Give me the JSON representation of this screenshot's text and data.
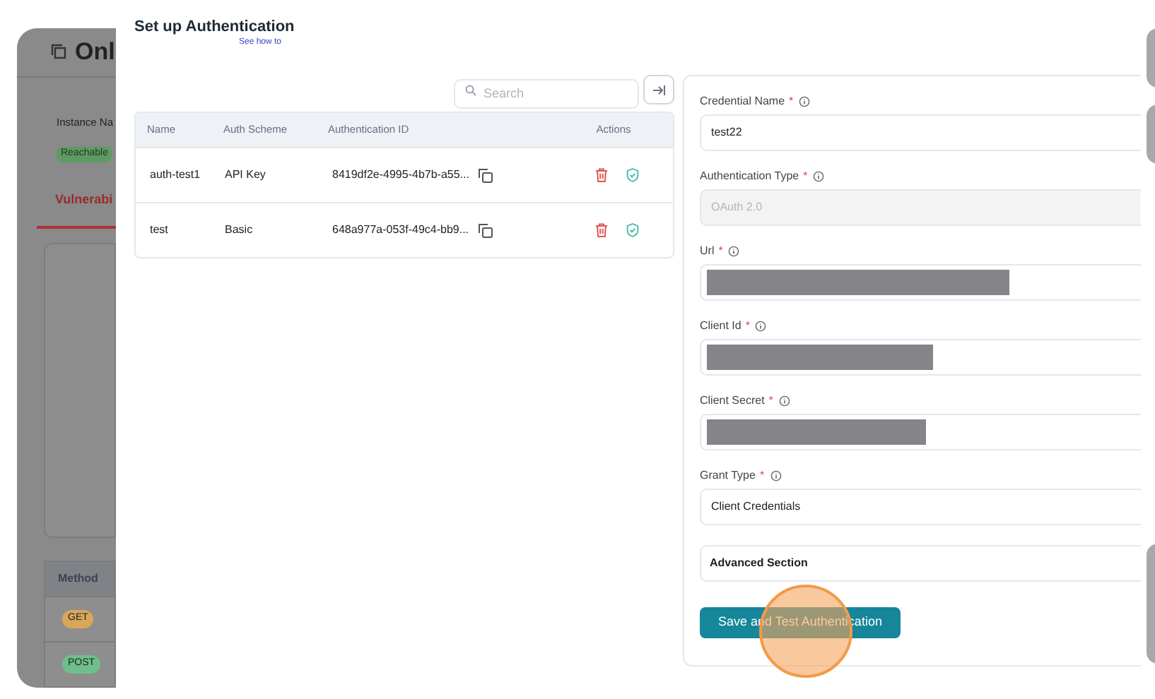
{
  "background_page": {
    "title": "Onl",
    "instance_label": "Instance Na",
    "status_badge": "Reachable",
    "tab": "Vulnerabi",
    "table": {
      "column": "Method",
      "rows": [
        {
          "method": "GET",
          "color": "#d9a75a"
        },
        {
          "method": "POST",
          "color": "#6fbf8a"
        }
      ]
    }
  },
  "drawer": {
    "title": "Set up Authentication",
    "help_link": "See how to",
    "search": {
      "placeholder": "Search"
    },
    "table": {
      "columns": [
        "Name",
        "Auth Scheme",
        "Authentication ID",
        "Actions"
      ],
      "rows": [
        {
          "name": "auth-test1",
          "scheme": "API Key",
          "id": "8419df2e-4995-4b7b-a55..."
        },
        {
          "name": "test",
          "scheme": "Basic",
          "id": "648a977a-053f-49c4-bb9..."
        }
      ]
    },
    "form": {
      "fields": [
        {
          "label": "Credential Name",
          "required_mark": "*",
          "kind": "text",
          "value": "test22"
        },
        {
          "label": "Authentication Type",
          "required_mark": "*",
          "kind": "disabled",
          "value": "OAuth 2.0"
        },
        {
          "label": "Url",
          "required_mark": "*",
          "kind": "redacted"
        },
        {
          "label": "Client Id",
          "required_mark": "*",
          "kind": "redacted"
        },
        {
          "label": "Client Secret",
          "required_mark": "*",
          "kind": "redacted"
        },
        {
          "label": "Grant Type",
          "required_mark": "*",
          "kind": "text",
          "value": "Client Credentials"
        }
      ],
      "advanced_section": "Advanced Section",
      "submit": "Save and Test Authentication"
    }
  }
}
